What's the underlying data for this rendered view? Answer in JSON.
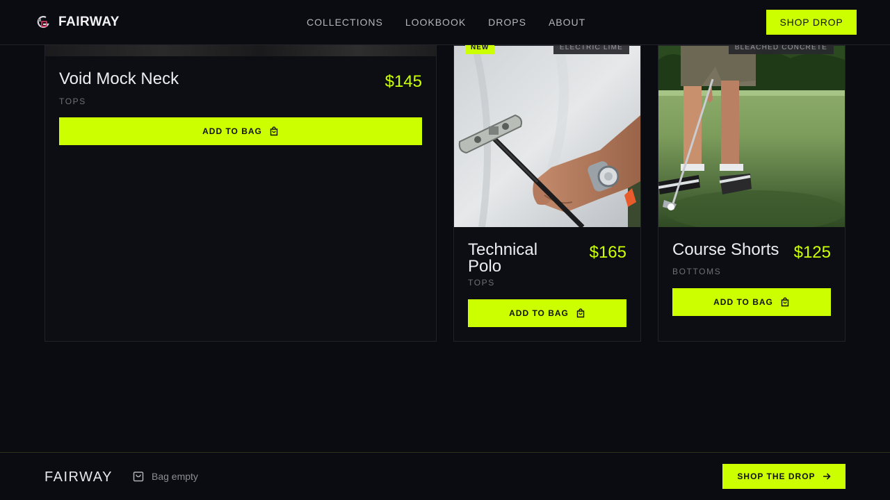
{
  "header": {
    "brand": "FAIRWAY",
    "nav": [
      "COLLECTIONS",
      "LOOKBOOK",
      "DROPS",
      "ABOUT"
    ],
    "cta": "SHOP DROP"
  },
  "products": [
    {
      "name": "Void Mock Neck",
      "price": "$145",
      "category": "TOPS",
      "button": "ADD TO BAG",
      "icon": "shopping-bag-icon"
    },
    {
      "name": "Technical Polo",
      "price": "$165",
      "category": "TOPS",
      "button": "ADD TO BAG",
      "badge": "NEW",
      "colorway": "ELECTRIC LIME",
      "icon": "shopping-bag-icon"
    },
    {
      "name": "Course Shorts",
      "price": "$125",
      "category": "BOTTOMS",
      "button": "ADD TO BAG",
      "colorway": "BLEACHED CONCRETE",
      "icon": "shopping-bag-icon"
    }
  ],
  "footer": {
    "brand": "FAIRWAY",
    "bag_status": "Bag empty",
    "cta": "SHOP THE DROP"
  },
  "colors": {
    "accent": "#ccff00",
    "background": "#0b0b12"
  }
}
